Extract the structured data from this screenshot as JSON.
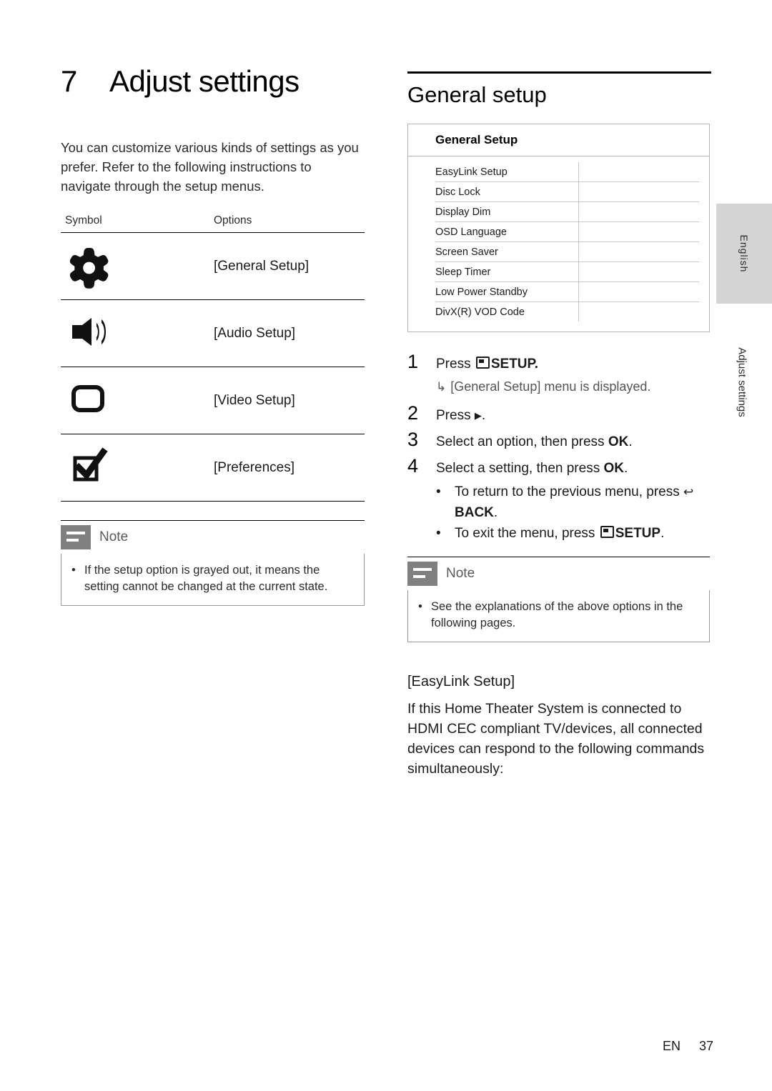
{
  "chapter": {
    "number": "7",
    "title": "Adjust settings",
    "intro": "You can customize various kinds of settings as you prefer. Refer to the following instructions to navigate through the setup menus."
  },
  "symbol_table": {
    "headers": [
      "Symbol",
      "Options"
    ],
    "rows": [
      {
        "icon": "gear-icon",
        "option": "[General Setup]"
      },
      {
        "icon": "speaker-icon",
        "option": "[Audio Setup]"
      },
      {
        "icon": "tv-screen-icon",
        "option": "[Video Setup]"
      },
      {
        "icon": "checkbox-check-icon",
        "option": "[Preferences]"
      }
    ]
  },
  "left_note": {
    "label": "Note",
    "bullet": "•",
    "text": "If the setup option is grayed out, it means the setting cannot be changed at the current state."
  },
  "general_setup": {
    "title": "General setup",
    "screen": {
      "header": "General Setup",
      "rows": [
        {
          "label": "EasyLink Setup",
          "value": ""
        },
        {
          "label": "Disc Lock",
          "value": ""
        },
        {
          "label": "Display Dim",
          "value": ""
        },
        {
          "label": "OSD Language",
          "value": ""
        },
        {
          "label": "Screen Saver",
          "value": ""
        },
        {
          "label": "Sleep Timer",
          "value": ""
        },
        {
          "label": "Low Power Standby",
          "value": ""
        },
        {
          "label": "DivX(R) VOD Code",
          "value": ""
        }
      ]
    },
    "steps": [
      {
        "num": "1",
        "text_before": "Press ",
        "icon": "setup-icon",
        "text_after": "SETUP."
      },
      {
        "num": "2",
        "text_before": "Press ",
        "icon": "right-arrow-icon",
        "text_after": "."
      },
      {
        "num": "3",
        "text_before": "Select an option, then press ",
        "bold": "OK",
        "text_after": "."
      },
      {
        "num": "4",
        "text_before": "Select a setting, then press ",
        "bold": "OK",
        "text_after": "."
      }
    ],
    "step1_result": "[General Setup] menu is displayed.",
    "bullets": [
      {
        "dot": "•",
        "before": "To return to the previous menu, press ",
        "icon": "back-icon",
        "bold": "BACK",
        "after": "."
      },
      {
        "dot": "•",
        "before": "To exit the menu, press ",
        "icon": "setup-icon",
        "bold": "SETUP",
        "after": "."
      }
    ]
  },
  "right_note": {
    "label": "Note",
    "bullet": "•",
    "text": "See the explanations of the above options in the following pages."
  },
  "easylink": {
    "title": "[EasyLink Setup]",
    "body": "If this Home Theater System is connected to HDMI CEC compliant TV/devices, all connected devices can respond to the following commands simultaneously:"
  },
  "side": {
    "language_tab": "English",
    "section_label": "Adjust settings"
  },
  "footer": {
    "locale": "EN",
    "page": "37"
  },
  "colors": {
    "tab_bg": "#d4d4d4",
    "note_icon": "#808080",
    "rule": "#000000"
  }
}
